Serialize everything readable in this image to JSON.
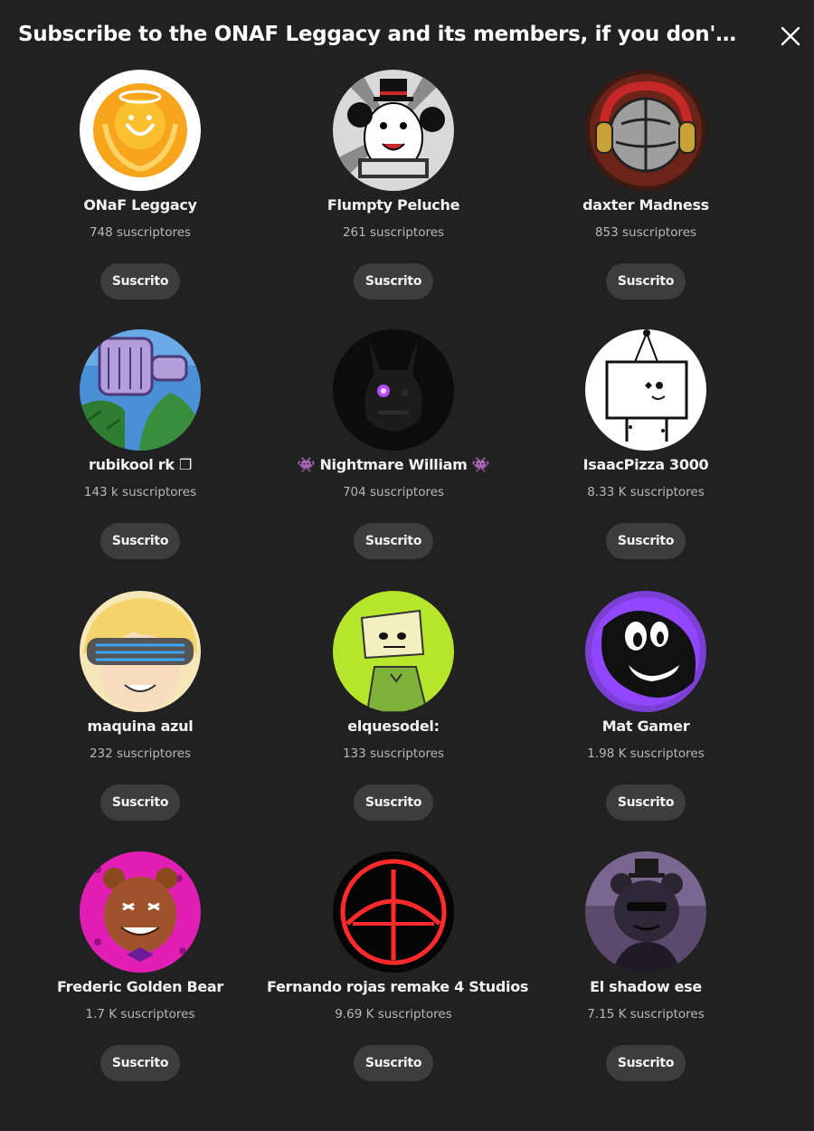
{
  "dialog": {
    "title": "Subscribe to the ONAF Leggacy and its members, if you don't want...",
    "close_icon": "close-icon"
  },
  "channels": [
    {
      "name": "ONaF Leggacy",
      "subscribers": "748 suscriptores",
      "button_label": "Suscrito",
      "avatar": "golden-laurel-smile-logo"
    },
    {
      "name": "Flumpty Peluche",
      "subscribers": "261 suscriptores",
      "button_label": "Suscrito",
      "avatar": "egg-with-top-hat"
    },
    {
      "name": "daxter Madness",
      "subscribers": "853 suscriptores",
      "button_label": "Suscrito",
      "avatar": "grey-ball-with-headphones"
    },
    {
      "name": "rubikool rk ❒",
      "subscribers": "143 k suscriptores",
      "button_label": "Suscrito",
      "avatar": "purple-fist-green-hand"
    },
    {
      "name": "👾 Nightmare William 👾",
      "subscribers": "704 suscriptores",
      "button_label": "Suscrito",
      "avatar": "dark-animatronic-glowing-eye"
    },
    {
      "name": "IsaacPizza 3000",
      "subscribers": "8.33 K suscriptores",
      "button_label": "Suscrito",
      "avatar": "box-clown-drawing"
    },
    {
      "name": "maquina azul",
      "subscribers": "232 suscriptores",
      "button_label": "Suscrito",
      "avatar": "blonde-visor-character"
    },
    {
      "name": "elquesodel:",
      "subscribers": "133 suscriptores",
      "button_label": "Suscrito",
      "avatar": "green-doodle-character"
    },
    {
      "name": "Mat Gamer",
      "subscribers": "1.98 K suscriptores",
      "button_label": "Suscrito",
      "avatar": "purple-cartoon-character"
    },
    {
      "name": "Frederic Golden Bear",
      "subscribers": "1.7 K suscriptores",
      "button_label": "Suscrito",
      "avatar": "magenta-bear-animatronic"
    },
    {
      "name": "Fernando rojas remake 4 Studios",
      "subscribers": "9.69 K suscriptores",
      "button_label": "Suscrito",
      "avatar": "red-neon-circle-logo"
    },
    {
      "name": "El shadow ese",
      "subscribers": "7.15 K suscriptores",
      "button_label": "Suscrito",
      "avatar": "shadow-bear-with-hat"
    }
  ],
  "colors": {
    "background": "#212121",
    "button_background": "#3d3d3d",
    "text_primary": "#f1f1f1",
    "text_secondary": "#b8b8b8"
  }
}
